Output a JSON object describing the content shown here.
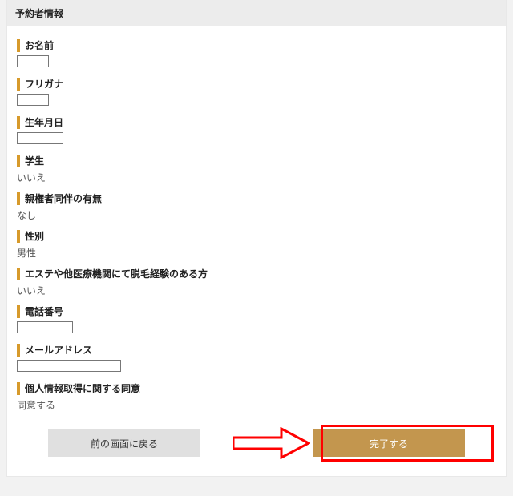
{
  "header": {
    "title": "予約者情報"
  },
  "fields": {
    "name": {
      "label": "お名前"
    },
    "furigana": {
      "label": "フリガナ"
    },
    "dob": {
      "label": "生年月日"
    },
    "student": {
      "label": "学生",
      "value": "いいえ"
    },
    "guardian": {
      "label": "親権者同伴の有無",
      "value": "なし"
    },
    "gender": {
      "label": "性別",
      "value": "男性"
    },
    "experience": {
      "label": "エステや他医療機関にて脱毛経験のある方",
      "value": "いいえ"
    },
    "phone": {
      "label": "電話番号"
    },
    "email": {
      "label": "メールアドレス"
    },
    "consent": {
      "label": "個人情報取得に関する同意",
      "value": "同意する"
    }
  },
  "buttons": {
    "back": "前の画面に戻る",
    "complete": "完了する"
  }
}
